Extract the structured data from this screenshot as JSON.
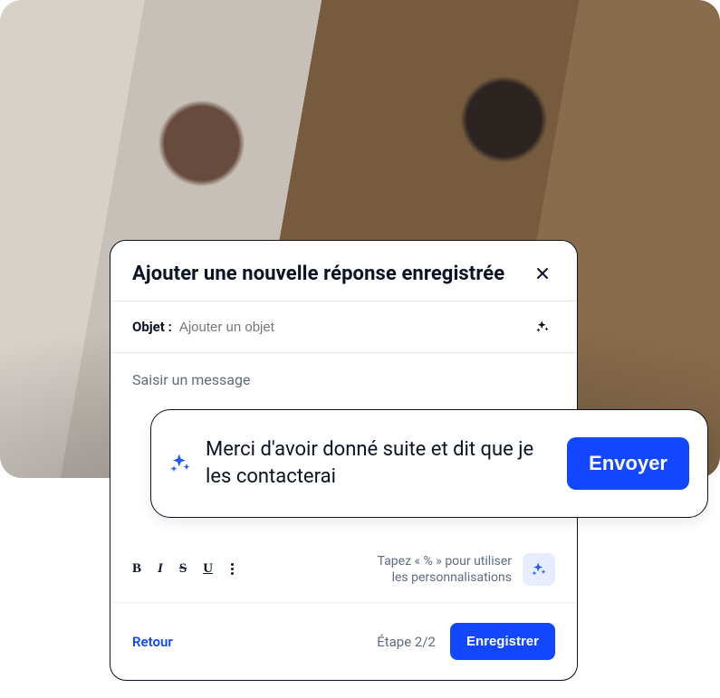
{
  "modal": {
    "title": "Ajouter une nouvelle réponse enregistrée",
    "subject_label": "Objet :",
    "subject_placeholder": "Ajouter un objet",
    "body_placeholder": "Saisir un message",
    "tips_line1": "Tapez « % » pour utiliser",
    "tips_line2": "les personnalisations",
    "back_label": "Retour",
    "step_text": "Étape 2/2",
    "save_label": "Enregistrer"
  },
  "suggestion": {
    "text": "Merci d'avoir donné suite et dit que je les contacterai",
    "send_label": "Envoyer"
  },
  "colors": {
    "accent": "#1246ff",
    "ink": "#0b1324",
    "muted": "#5f6b7d"
  }
}
